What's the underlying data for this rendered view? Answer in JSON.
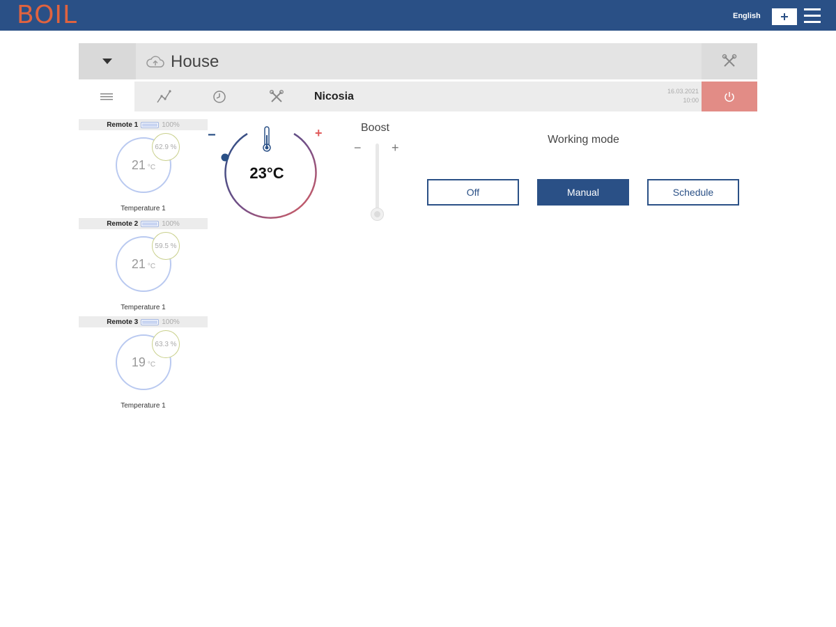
{
  "header": {
    "logo": "BOIL",
    "language": "English"
  },
  "house": {
    "name": "House"
  },
  "tabs_row": {
    "location": "Nicosia",
    "date": "16.03.2021",
    "time": "10:00"
  },
  "remotes": [
    {
      "name": "Remote 1",
      "battery": "100%",
      "battery_level": 1.0,
      "temperature": "21",
      "unit": "°C",
      "humidity": "62.9 %",
      "label": "Temperature 1"
    },
    {
      "name": "Remote 2",
      "battery": "100%",
      "battery_level": 1.0,
      "temperature": "21",
      "unit": "°C",
      "humidity": "59.5 %",
      "label": "Temperature 1"
    },
    {
      "name": "Remote 3",
      "battery": "100%",
      "battery_level": 1.0,
      "temperature": "19",
      "unit": "°C",
      "humidity": "63.3 %",
      "label": "Temperature 1"
    }
  ],
  "thermostat": {
    "minus": "−",
    "plus": "+",
    "setpoint": "23°C"
  },
  "boost": {
    "label": "Boost",
    "minus": "−",
    "plus": "+",
    "level": 0
  },
  "working_mode": {
    "title": "Working mode",
    "options": [
      "Off",
      "Manual",
      "Schedule"
    ],
    "selected": "Manual"
  },
  "colors": {
    "brand_blue": "#2a5086",
    "logo_orange": "#e0633f",
    "power_red": "#e28c86"
  }
}
